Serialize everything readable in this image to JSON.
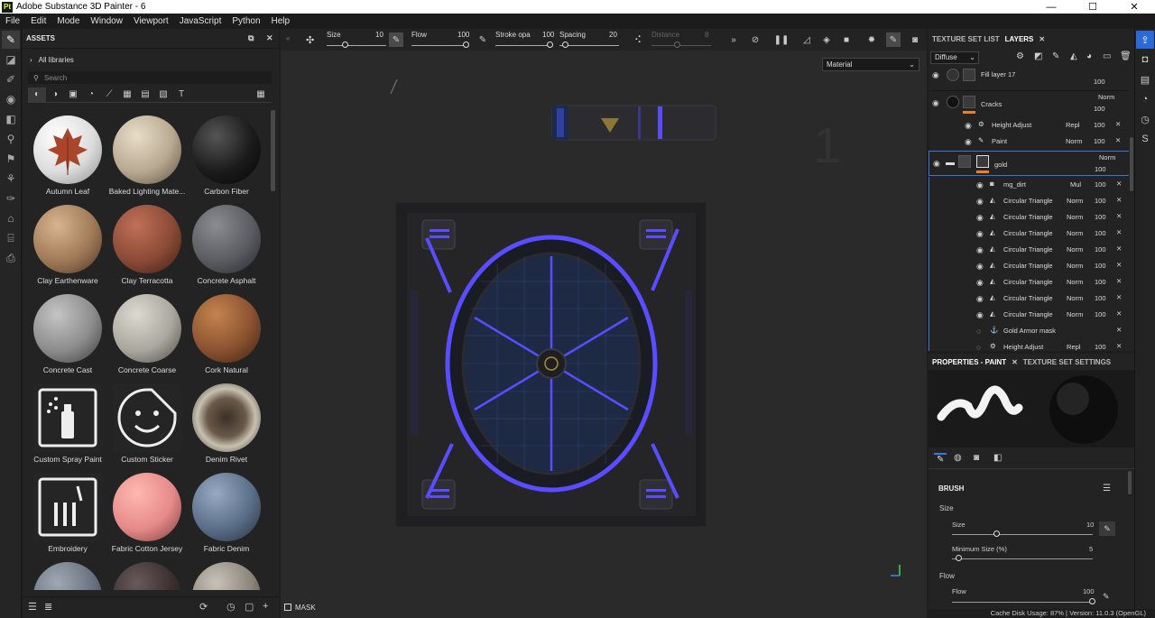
{
  "app": {
    "title": "Adobe Substance 3D Painter - 6"
  },
  "window_controls": {
    "minimize": "—",
    "maximize": "☐",
    "close": "✕"
  },
  "menu": [
    "File",
    "Edit",
    "Mode",
    "Window",
    "Viewport",
    "JavaScript",
    "Python",
    "Help"
  ],
  "assets": {
    "header": "ASSETS",
    "breadcrumb": "All libraries",
    "search_placeholder": "Search",
    "items": [
      {
        "label": "Autumn Leaf",
        "color": "#e8e8e8"
      },
      {
        "label": "Baked Lighting Mate...",
        "color": "#b8a890"
      },
      {
        "label": "Carbon Fiber",
        "color": "#1b1b1b"
      },
      {
        "label": "Clay Earthenware",
        "color": "#a07a58"
      },
      {
        "label": "Clay Terracotta",
        "color": "#8a4a36"
      },
      {
        "label": "Concrete Asphalt",
        "color": "#5a5c62"
      },
      {
        "label": "Concrete Cast",
        "color": "#8c8c8c"
      },
      {
        "label": "Concrete Coarse",
        "color": "#a9a79e"
      },
      {
        "label": "Cork Natural",
        "color": "#8a5230"
      },
      {
        "label": "Custom Spray Paint",
        "icon": "spray-icon"
      },
      {
        "label": "Custom Sticker",
        "icon": "sticker-icon"
      },
      {
        "label": "Denim Rivet",
        "color": "#6a5a4a"
      },
      {
        "label": "Embroidery",
        "icon": "embroidery-icon"
      },
      {
        "label": "Fabric Cotton Jersey",
        "color": "#e58a8a"
      },
      {
        "label": "Fabric Denim",
        "color": "#5a6e88"
      }
    ]
  },
  "toolbar": {
    "size_label": "Size",
    "size_value": "10",
    "flow_label": "Flow",
    "flow_value": "100",
    "stroke_label": "Stroke opa",
    "stroke_value": "100",
    "spacing_label": "Spacing",
    "spacing_value": "20",
    "distance_label": "Distance",
    "distance_value": "8"
  },
  "viewport": {
    "material_select": "Material",
    "mask_label": "MASK"
  },
  "layers_panel": {
    "tab_texture_set": "TEXTURE SET LIST",
    "tab_layers": "LAYERS",
    "channel": "Diffuse",
    "rows": [
      {
        "name": "Fill layer 17",
        "blend": "",
        "opacity": "100"
      },
      {
        "name": "Cracks",
        "blend": "Norm",
        "opacity": "100"
      },
      {
        "name": "Height Adjust",
        "blend": "Repl",
        "opacity": "100"
      },
      {
        "name": "Paint",
        "blend": "Norm",
        "opacity": "100"
      },
      {
        "name": "gold",
        "blend": "Norm",
        "opacity": "100"
      },
      {
        "name": "mg_dirt",
        "blend": "Mul",
        "opacity": "100"
      },
      {
        "name": "Circular Triangle",
        "blend": "Norm",
        "opacity": "100"
      },
      {
        "name": "Circular Triangle",
        "blend": "Norm",
        "opacity": "100"
      },
      {
        "name": "Circular Triangle",
        "blend": "Norm",
        "opacity": "100"
      },
      {
        "name": "Circular Triangle",
        "blend": "Norm",
        "opacity": "100"
      },
      {
        "name": "Circular Triangle",
        "blend": "Norm",
        "opacity": "100"
      },
      {
        "name": "Circular Triangle",
        "blend": "Norm",
        "opacity": "100"
      },
      {
        "name": "Circular Triangle",
        "blend": "Norm",
        "opacity": "100"
      },
      {
        "name": "Circular Triangle",
        "blend": "Norm",
        "opacity": "100"
      },
      {
        "name": "Gold Armor mask",
        "blend": "",
        "opacity": ""
      },
      {
        "name": "Height Adjust",
        "blend": "Repl",
        "opacity": "100"
      }
    ]
  },
  "properties": {
    "tab_paint": "PROPERTIES - PAINT",
    "tab_settings": "TEXTURE SET SETTINGS",
    "section": "BRUSH",
    "size_group": "Size",
    "size_label": "Size",
    "size_value": "10",
    "size_fraction": 0.32,
    "minsize_label": "Minimum Size (%)",
    "minsize_value": "5",
    "minsize_fraction": 0.05,
    "flow_group": "Flow",
    "flow_label": "Flow",
    "flow_value": "100",
    "flow_fraction": 1.0
  },
  "status": {
    "text": "Cache Disk Usage:  87% | Version: 11.0.3 (OpenGL)"
  },
  "colors": {
    "accent_orange": "#e8822a",
    "neon_blue": "#5a4dff",
    "selection_blue": "#3c78d8"
  }
}
